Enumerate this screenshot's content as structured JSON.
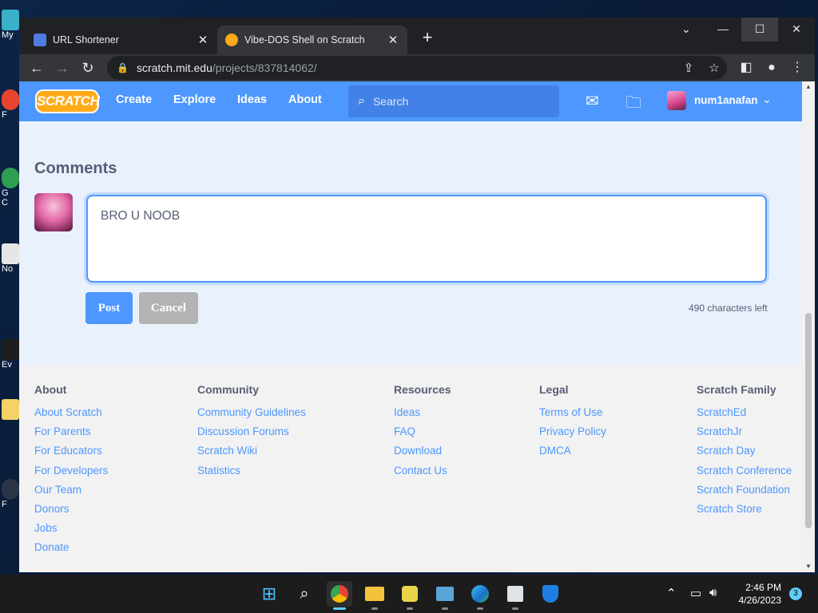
{
  "desktop": {
    "icon_labels": [
      "My",
      "F",
      "G",
      "C",
      "No",
      "Ev",
      "F"
    ]
  },
  "browser": {
    "tabs": [
      {
        "title": "URL Shortener"
      },
      {
        "title": "Vibe-DOS Shell on Scratch"
      }
    ],
    "new_tab": "+",
    "url_host": "scratch.mit.edu",
    "url_path": "/projects/837814062/"
  },
  "scratch": {
    "logo": "SCRATCH",
    "nav": [
      "Create",
      "Explore",
      "Ideas",
      "About"
    ],
    "search_placeholder": "Search",
    "username": "num1anafan"
  },
  "comments": {
    "title": "Comments",
    "draft": "BRO U NOOB",
    "post_label": "Post",
    "cancel_label": "Cancel",
    "chars_left": "490 characters left"
  },
  "footer": {
    "columns": [
      {
        "heading": "About",
        "links": [
          "About Scratch",
          "For Parents",
          "For Educators",
          "For Developers",
          "Our Team",
          "Donors",
          "Jobs",
          "Donate"
        ]
      },
      {
        "heading": "Community",
        "links": [
          "Community Guidelines",
          "Discussion Forums",
          "Scratch Wiki",
          "Statistics"
        ]
      },
      {
        "heading": "Resources",
        "links": [
          "Ideas",
          "FAQ",
          "Download",
          "Contact Us"
        ]
      },
      {
        "heading": "Legal",
        "links": [
          "Terms of Use",
          "Privacy Policy",
          "DMCA"
        ]
      },
      {
        "heading": "Scratch Family",
        "links": [
          "ScratchEd",
          "ScratchJr",
          "Scratch Day",
          "Scratch Conference",
          "Scratch Foundation",
          "Scratch Store"
        ]
      }
    ]
  },
  "taskbar": {
    "time": "2:46 PM",
    "date": "4/26/2023",
    "notification_count": "3"
  },
  "colors": {
    "scratch_blue": "#4d97ff",
    "scratch_orange": "#ffab19",
    "comment_bg": "#e9f1fc"
  }
}
